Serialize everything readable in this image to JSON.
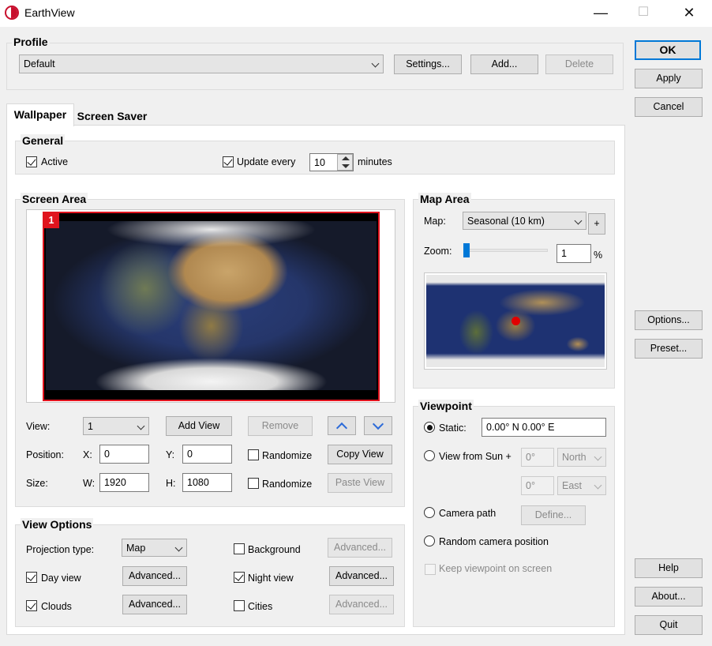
{
  "window": {
    "title": "EarthView",
    "minimize": "—",
    "maximize": "☐",
    "close": "✕"
  },
  "profile": {
    "label": "Profile",
    "value": "Default",
    "settings": "Settings...",
    "add": "Add...",
    "delete": "Delete"
  },
  "side": {
    "ok": "OK",
    "apply": "Apply",
    "cancel": "Cancel",
    "options": "Options...",
    "preset": "Preset...",
    "help": "Help",
    "about": "About...",
    "quit": "Quit"
  },
  "tabs": [
    "Wallpaper",
    "Screen Saver"
  ],
  "general": {
    "label": "General",
    "active": "Active",
    "update_every": "Update every",
    "interval": "10",
    "minutes": "minutes"
  },
  "screen_area": {
    "label": "Screen Area",
    "screen_number": "1",
    "view_label": "View:",
    "view_value": "1",
    "add_view": "Add View",
    "remove": "Remove",
    "position_label": "Position:",
    "x_label": "X:",
    "x": "0",
    "y_label": "Y:",
    "y": "0",
    "randomize": "Randomize",
    "copy_view": "Copy View",
    "size_label": "Size:",
    "w_label": "W:",
    "w": "1920",
    "h_label": "H:",
    "h": "1080",
    "randomize2": "Randomize",
    "paste_view": "Paste View"
  },
  "map_area": {
    "label": "Map Area",
    "map_label": "Map:",
    "map_value": "Seasonal (10 km)",
    "plus": "+",
    "zoom_label": "Zoom:",
    "zoom_value": "1",
    "zoom_level": 0.0,
    "percent": "%"
  },
  "viewpoint": {
    "label": "Viewpoint",
    "static": "Static:",
    "static_value": "0.00° N   0.00° E",
    "view_from_sun": "View from Sun +",
    "lat": "0°",
    "lat_dir": "North",
    "lon": "0°",
    "lon_dir": "East",
    "camera_path": "Camera path",
    "define": "Define...",
    "random_camera": "Random camera position",
    "keep_on_screen": "Keep viewpoint on screen"
  },
  "view_options": {
    "label": "View Options",
    "projection_label": "Projection type:",
    "projection_value": "Map",
    "background": "Background",
    "advanced": "Advanced...",
    "day_view": "Day view",
    "night_view": "Night view",
    "clouds": "Clouds",
    "cities": "Cities"
  },
  "colors": {
    "accent": "#0078d7",
    "screen_border": "#e0141e",
    "marker": "#e00000"
  }
}
